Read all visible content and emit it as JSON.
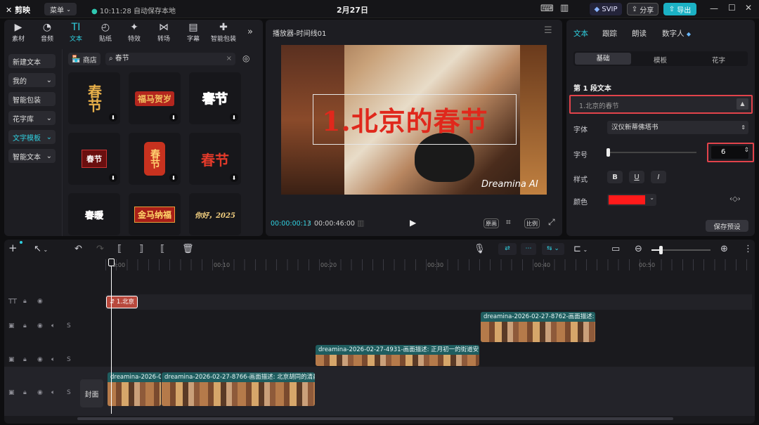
{
  "app": {
    "logo": "剪映",
    "menu": "菜单",
    "save_status": "10:11:28 自动保存本地",
    "date_title": "2月27日",
    "svip": "SVIP",
    "share": "分享",
    "export": "导出"
  },
  "tools": [
    {
      "label": "素材",
      "icon": "▶"
    },
    {
      "label": "音频",
      "icon": "◔"
    },
    {
      "label": "文本",
      "icon": "TI"
    },
    {
      "label": "贴纸",
      "icon": "◴"
    },
    {
      "label": "特效",
      "icon": "✦"
    },
    {
      "label": "转场",
      "icon": "⋈"
    },
    {
      "label": "字幕",
      "icon": "▤"
    },
    {
      "label": "智能包装",
      "icon": "✚"
    }
  ],
  "left_nav": [
    {
      "label": "新建文本"
    },
    {
      "label": "我的",
      "caret": "⌄"
    },
    {
      "label": "智能包装"
    },
    {
      "label": "花字库",
      "caret": "⌄"
    },
    {
      "label": "文字模板",
      "caret": "⌄"
    },
    {
      "label": "智能文本",
      "caret": "⌄"
    }
  ],
  "store": "商店",
  "search": {
    "value": "春节"
  },
  "templates": [
    {
      "text": "春节",
      "color": "#e8b04a"
    },
    {
      "text": "福马贺岁",
      "color": "#f0c060"
    },
    {
      "text": "春节",
      "color": "#7be0d0"
    },
    {
      "text": "春节",
      "color": "#ffffff"
    },
    {
      "text": "春节",
      "color": "#ffd070"
    },
    {
      "text": "春节",
      "color": "#e33a2a"
    },
    {
      "text": "春暖",
      "color": "#ff5a4a"
    },
    {
      "text": "金马纳福",
      "color": "#ffd56a"
    },
    {
      "text": "你好，2025",
      "color": "#f4d080"
    }
  ],
  "player": {
    "title": "播放器-时间线01",
    "overlay_text": "1.北京的春节",
    "watermark": "Dreamina AI",
    "current_time": "00:00:00:13",
    "total_time": "00:00:46:00",
    "btn_original": "原画",
    "btn_ratio": "比例"
  },
  "props": {
    "tabs": [
      "文本",
      "跟踪",
      "朗读",
      "数字人"
    ],
    "subtabs": [
      "基础",
      "模板",
      "花字"
    ],
    "section": "第 1 段文本",
    "text_value": "1.北京的春节",
    "font_label": "字体",
    "font_value": "汉仪新蒂佛塔书",
    "size_label": "字号",
    "size_value": "6",
    "style_label": "样式",
    "style_b": "B",
    "style_u": "U",
    "style_i": "I",
    "color_label": "颜色",
    "color_value": "#ff1a1a",
    "save_preset": "保存预设"
  },
  "timeline": {
    "ruler": [
      "00:00",
      "00:10",
      "00:20",
      "00:30",
      "00:40",
      "00:50"
    ],
    "text_clip": "1.北京",
    "clips": {
      "c1": "dreamina-2026-02-27-8762-画面描述:",
      "c2": "dreamina-2026-02-27-4931-画面描述:  正月初一的街道安",
      "c3a": "dreamina-2026-0",
      "c3b": "dreamina-2026-02-27-8766-画面描述:  北京胡同的清晨"
    },
    "cover": "封面"
  }
}
